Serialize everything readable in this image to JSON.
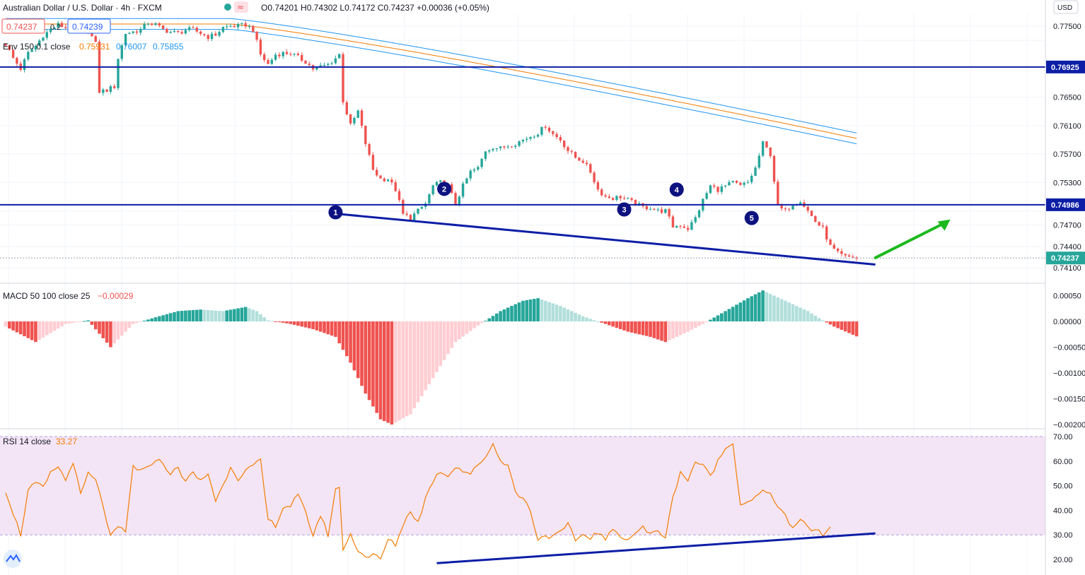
{
  "header": {
    "symbol": "Australian Dollar / U.S. Dollar · 4h · FXCM",
    "ohlc": "O0.74201  H0.74302  L0.74172  C0.74237  +0.00036 (+0.05%)",
    "bid": "0.74237",
    "spread": "0.2",
    "ask": "0.74239",
    "currency": "USD"
  },
  "env": {
    "label": "Env 150 0.1 close",
    "v1": "0.75931",
    "v2": "0.76007",
    "v3": "0.75855"
  },
  "macd": {
    "label": "MACD 50 100 close 25",
    "value": "−0.00029"
  },
  "rsi": {
    "label": "RSI 14 close",
    "value": "33.27"
  },
  "price_badges": {
    "upper_level": "0.76925",
    "lower_level": "0.74986",
    "last": "0.74237"
  },
  "wave_labels": [
    "1",
    "2",
    "3",
    "4",
    "5"
  ],
  "colors": {
    "up": "#26a69a",
    "down": "#ef5350",
    "hist_up_strong": "#26a69a",
    "hist_up_weak": "#b2dfdb",
    "hist_down_strong": "#ef5350",
    "hist_down_weak": "#ffcdd2",
    "env_mid": "#f57c00",
    "env_band": "#2196f3",
    "hline": "#0d1ea6",
    "rsi_line": "#f57c00",
    "rsi_bg": "#f3e5f5",
    "arrow": "#1db91d"
  },
  "chart_data": [
    {
      "type": "candlestick",
      "title": "Australian Dollar / U.S. Dollar · 4h · FXCM",
      "ylim": [
        0.74,
        0.778
      ],
      "y_ticks": [
        "0.77500",
        "0.76500",
        "0.76100",
        "0.75700",
        "0.75300",
        "0.74700",
        "0.74400",
        "0.74100"
      ],
      "horizontal_levels": [
        0.76925,
        0.74986
      ],
      "last_price": 0.74237,
      "path_points": [
        [
          0,
          0.7725
        ],
        [
          2,
          0.7705
        ],
        [
          4,
          0.769
        ],
        [
          6,
          0.7712
        ],
        [
          8,
          0.7722
        ],
        [
          10,
          0.7737
        ],
        [
          12,
          0.7745
        ],
        [
          14,
          0.7752
        ],
        [
          16,
          0.7748
        ],
        [
          18,
          0.7752
        ],
        [
          20,
          0.7752
        ],
        [
          22,
          0.7745
        ],
        [
          24,
          0.7725
        ],
        [
          25,
          0.7658
        ],
        [
          27,
          0.766
        ],
        [
          29,
          0.7665
        ],
        [
          30,
          0.7705
        ],
        [
          32,
          0.774
        ],
        [
          34,
          0.7742
        ],
        [
          36,
          0.7745
        ],
        [
          38,
          0.7755
        ],
        [
          40,
          0.7752
        ],
        [
          42,
          0.7745
        ],
        [
          44,
          0.7742
        ],
        [
          46,
          0.774
        ],
        [
          48,
          0.7745
        ],
        [
          50,
          0.7745
        ],
        [
          52,
          0.774
        ],
        [
          54,
          0.7735
        ],
        [
          56,
          0.7738
        ],
        [
          58,
          0.7748
        ],
        [
          60,
          0.775
        ],
        [
          62,
          0.775
        ],
        [
          64,
          0.7752
        ],
        [
          66,
          0.7745
        ],
        [
          68,
          0.771
        ],
        [
          70,
          0.7696
        ],
        [
          72,
          0.771
        ],
        [
          74,
          0.7712
        ],
        [
          76,
          0.7712
        ],
        [
          78,
          0.7706
        ],
        [
          80,
          0.77
        ],
        [
          82,
          0.769
        ],
        [
          84,
          0.7693
        ],
        [
          86,
          0.7696
        ],
        [
          88,
          0.7705
        ],
        [
          89,
          0.771
        ],
        [
          90,
          0.7645
        ],
        [
          92,
          0.761
        ],
        [
          94,
          0.763
        ],
        [
          96,
          0.7585
        ],
        [
          98,
          0.7548
        ],
        [
          100,
          0.7535
        ],
        [
          102,
          0.7535
        ],
        [
          104,
          0.752
        ],
        [
          106,
          0.7485
        ],
        [
          108,
          0.748
        ],
        [
          110,
          0.749
        ],
        [
          112,
          0.75
        ],
        [
          114,
          0.7525
        ],
        [
          116,
          0.753
        ],
        [
          118,
          0.7525
        ],
        [
          120,
          0.75
        ],
        [
          122,
          0.7525
        ],
        [
          124,
          0.7545
        ],
        [
          126,
          0.755
        ],
        [
          128,
          0.7575
        ],
        [
          130,
          0.758
        ],
        [
          132,
          0.7578
        ],
        [
          134,
          0.7582
        ],
        [
          136,
          0.7585
        ],
        [
          138,
          0.759
        ],
        [
          140,
          0.7595
        ],
        [
          142,
          0.76
        ],
        [
          144,
          0.761
        ],
        [
          146,
          0.7598
        ],
        [
          148,
          0.759
        ],
        [
          150,
          0.7575
        ],
        [
          152,
          0.7565
        ],
        [
          154,
          0.756
        ],
        [
          156,
          0.7545
        ],
        [
          158,
          0.752
        ],
        [
          160,
          0.751
        ],
        [
          162,
          0.7508
        ],
        [
          164,
          0.751
        ],
        [
          166,
          0.7505
        ],
        [
          168,
          0.75
        ],
        [
          170,
          0.7495
        ],
        [
          172,
          0.7495
        ],
        [
          174,
          0.749
        ],
        [
          176,
          0.749
        ],
        [
          178,
          0.7468
        ],
        [
          180,
          0.747
        ],
        [
          182,
          0.7465
        ],
        [
          184,
          0.748
        ],
        [
          186,
          0.7505
        ],
        [
          188,
          0.7525
        ],
        [
          190,
          0.752
        ],
        [
          192,
          0.7525
        ],
        [
          194,
          0.753
        ],
        [
          196,
          0.7525
        ],
        [
          198,
          0.753
        ],
        [
          200,
          0.755
        ],
        [
          202,
          0.7585
        ],
        [
          204,
          0.757
        ],
        [
          206,
          0.7495
        ],
        [
          208,
          0.749
        ],
        [
          210,
          0.75
        ],
        [
          212,
          0.7505
        ],
        [
          214,
          0.749
        ],
        [
          216,
          0.7475
        ],
        [
          218,
          0.7465
        ],
        [
          220,
          0.744
        ],
        [
          222,
          0.743
        ],
        [
          224,
          0.7425
        ],
        [
          226,
          0.7425
        ],
        [
          227,
          0.74237
        ]
      ],
      "annotations": [
        {
          "label": "1",
          "x": 88,
          "y": 0.7488
        },
        {
          "label": "2",
          "x": 117,
          "y": 0.7521
        },
        {
          "label": "3",
          "x": 165,
          "y": 0.7492
        },
        {
          "label": "4",
          "x": 179,
          "y": 0.752
        },
        {
          "label": "5",
          "x": 199,
          "y": 0.748
        }
      ]
    },
    {
      "type": "bar",
      "title": "MACD 50 100 close 25",
      "ylim": [
        -0.0021,
        0.00062
      ],
      "y_ticks": [
        "0.00050",
        "0.00000",
        "−0.00050",
        "−0.00100",
        "−0.00150",
        "−0.00200"
      ],
      "path_points": [
        [
          0,
          -0.0001
        ],
        [
          8,
          -0.0004
        ],
        [
          16,
          -5e-05
        ],
        [
          22,
          2e-05
        ],
        [
          28,
          -0.0005
        ],
        [
          34,
          -5e-05
        ],
        [
          40,
          8e-05
        ],
        [
          46,
          0.0002
        ],
        [
          52,
          0.00023
        ],
        [
          58,
          0.0002
        ],
        [
          64,
          0.00028
        ],
        [
          67,
          0.0002
        ],
        [
          70,
          2e-05
        ],
        [
          76,
          -5e-05
        ],
        [
          82,
          -0.00015
        ],
        [
          88,
          -0.0003
        ],
        [
          92,
          -0.0008
        ],
        [
          96,
          -0.0014
        ],
        [
          100,
          -0.0019
        ],
        [
          103,
          -0.002
        ],
        [
          108,
          -0.0018
        ],
        [
          114,
          -0.0011
        ],
        [
          120,
          -0.0004
        ],
        [
          126,
          -8e-05
        ],
        [
          132,
          0.0002
        ],
        [
          138,
          0.0004
        ],
        [
          142,
          0.00045
        ],
        [
          148,
          0.0003
        ],
        [
          154,
          0.0001
        ],
        [
          160,
          -5e-05
        ],
        [
          166,
          -0.0002
        ],
        [
          172,
          -0.0003
        ],
        [
          176,
          -0.0004
        ],
        [
          182,
          -0.0002
        ],
        [
          186,
          -5e-05
        ],
        [
          192,
          0.0002
        ],
        [
          198,
          0.00045
        ],
        [
          202,
          0.0006
        ],
        [
          208,
          0.0004
        ],
        [
          214,
          0.0002
        ],
        [
          218,
          2e-05
        ],
        [
          221,
          -0.0001
        ],
        [
          227,
          -0.00029
        ]
      ]
    },
    {
      "type": "line",
      "title": "RSI 14 close",
      "ylim": [
        17,
        71
      ],
      "y_ticks": [
        "70.00",
        "60.00",
        "50.00",
        "40.00",
        "30.00",
        "20.00"
      ],
      "band": [
        30,
        70
      ],
      "last_value": 33.27,
      "path_points": [
        [
          0,
          48
        ],
        [
          4,
          30
        ],
        [
          6,
          48
        ],
        [
          8,
          51
        ],
        [
          10,
          49
        ],
        [
          12,
          55
        ],
        [
          14,
          58
        ],
        [
          16,
          52
        ],
        [
          18,
          60
        ],
        [
          20,
          46
        ],
        [
          22,
          55
        ],
        [
          24,
          52
        ],
        [
          26,
          42
        ],
        [
          28,
          29
        ],
        [
          30,
          33
        ],
        [
          32,
          31
        ],
        [
          34,
          58
        ],
        [
          36,
          56
        ],
        [
          38,
          57
        ],
        [
          40,
          61
        ],
        [
          42,
          59
        ],
        [
          44,
          55
        ],
        [
          46,
          57
        ],
        [
          48,
          52
        ],
        [
          50,
          55
        ],
        [
          52,
          52
        ],
        [
          54,
          55
        ],
        [
          56,
          44
        ],
        [
          58,
          50
        ],
        [
          60,
          58
        ],
        [
          62,
          53
        ],
        [
          64,
          56
        ],
        [
          66,
          58
        ],
        [
          68,
          60
        ],
        [
          70,
          36
        ],
        [
          72,
          34
        ],
        [
          74,
          41
        ],
        [
          76,
          42
        ],
        [
          78,
          46
        ],
        [
          80,
          39
        ],
        [
          82,
          30
        ],
        [
          84,
          38
        ],
        [
          86,
          30
        ],
        [
          88,
          48
        ],
        [
          89,
          50
        ],
        [
          90,
          24
        ],
        [
          92,
          30
        ],
        [
          94,
          24
        ],
        [
          96,
          21
        ],
        [
          98,
          22
        ],
        [
          100,
          20
        ],
        [
          102,
          28
        ],
        [
          104,
          26
        ],
        [
          106,
          34
        ],
        [
          108,
          40
        ],
        [
          110,
          35
        ],
        [
          112,
          45
        ],
        [
          114,
          52
        ],
        [
          116,
          56
        ],
        [
          118,
          54
        ],
        [
          120,
          58
        ],
        [
          122,
          56
        ],
        [
          124,
          55
        ],
        [
          126,
          58
        ],
        [
          128,
          62
        ],
        [
          130,
          67
        ],
        [
          132,
          60
        ],
        [
          134,
          59
        ],
        [
          136,
          47
        ],
        [
          138,
          45
        ],
        [
          140,
          40
        ],
        [
          142,
          28
        ],
        [
          144,
          30
        ],
        [
          146,
          29
        ],
        [
          148,
          31
        ],
        [
          150,
          34
        ],
        [
          152,
          28
        ],
        [
          154,
          30
        ],
        [
          156,
          29
        ],
        [
          158,
          31
        ],
        [
          160,
          28
        ],
        [
          162,
          32
        ],
        [
          164,
          30
        ],
        [
          166,
          28
        ],
        [
          168,
          31
        ],
        [
          170,
          33
        ],
        [
          172,
          30
        ],
        [
          174,
          32
        ],
        [
          176,
          29
        ],
        [
          178,
          45
        ],
        [
          180,
          56
        ],
        [
          182,
          52
        ],
        [
          184,
          60
        ],
        [
          186,
          58
        ],
        [
          188,
          54
        ],
        [
          190,
          60
        ],
        [
          192,
          65
        ],
        [
          194,
          68
        ],
        [
          196,
          42
        ],
        [
          198,
          44
        ],
        [
          200,
          45
        ],
        [
          202,
          48
        ],
        [
          204,
          46
        ],
        [
          206,
          42
        ],
        [
          208,
          38
        ],
        [
          210,
          32
        ],
        [
          212,
          36
        ],
        [
          214,
          33
        ],
        [
          216,
          32
        ],
        [
          218,
          30
        ],
        [
          220,
          33.27
        ]
      ]
    }
  ]
}
